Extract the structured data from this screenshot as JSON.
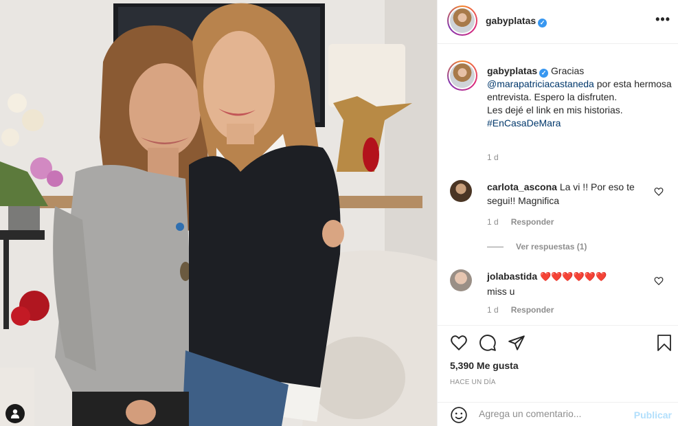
{
  "header": {
    "username": "gabyplatas",
    "verified_badge": "✓",
    "more_label": "•••"
  },
  "caption": {
    "username": "gabyplatas",
    "text_start": "Gracias",
    "mention": "@marapatriciacastaneda",
    "text_middle": "por esta hermosa entrevista. Espero la disfruten.",
    "text_line2": "Les dejé el link en mis historias.",
    "hashtag": "#EnCasaDeMara",
    "time": "1 d"
  },
  "comments": [
    {
      "username": "carlota_ascona",
      "text": "La vi !! Por eso te segui!! Magnifica",
      "time": "1 d",
      "reply_label": "Responder"
    },
    {
      "username": "jolabastida",
      "text": "miss u",
      "hearts": "❤️❤️❤️❤️❤️❤️",
      "time": "1 d",
      "reply_label": "Responder"
    }
  ],
  "view_replies": "Ver respuestas (1)",
  "likes": "5,390 Me gusta",
  "posted_ago": "HACE UN DÍA",
  "add_comment": {
    "placeholder": "Agrega un comentario...",
    "post_label": "Publicar"
  },
  "icons": [
    "heart-icon",
    "comment-icon",
    "share-icon",
    "bookmark-icon",
    "emoji-icon",
    "user-tag-icon",
    "more-icon"
  ],
  "colors": {
    "verified": "#3897f0",
    "link": "#00376b",
    "post_disabled": "#b2dffc",
    "heart_red": "#ed4956"
  }
}
